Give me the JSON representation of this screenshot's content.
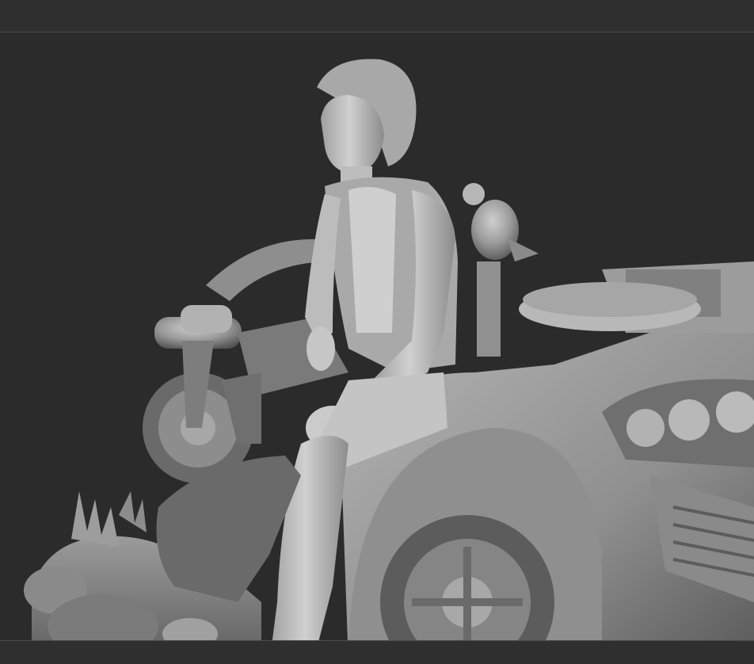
{
  "viewport": {
    "background_color": "#2b2b2b",
    "model_color": "#9a9a9a",
    "highlight_color": "#c9c9c9",
    "shadow_color": "#555555"
  },
  "scene": {
    "description_icon": "sculpt-preview-icon"
  }
}
